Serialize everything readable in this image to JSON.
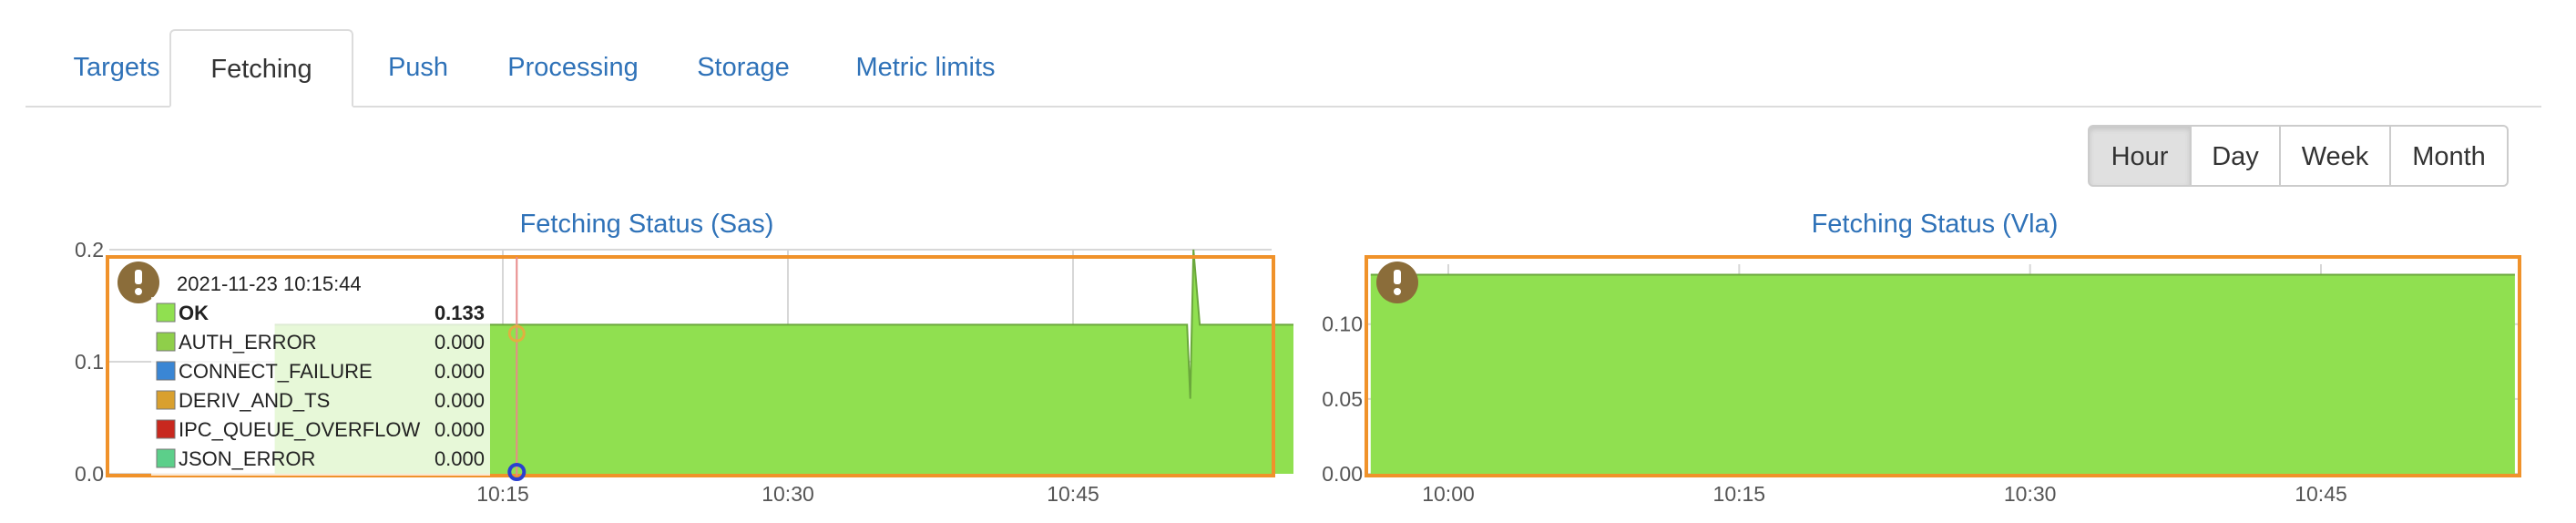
{
  "tabs": [
    {
      "label": "Targets",
      "active": false
    },
    {
      "label": "Fetching",
      "active": true
    },
    {
      "label": "Push",
      "active": false
    },
    {
      "label": "Processing",
      "active": false
    },
    {
      "label": "Storage",
      "active": false
    },
    {
      "label": "Metric limits",
      "active": false
    }
  ],
  "time_range": {
    "options": [
      "Hour",
      "Day",
      "Week",
      "Month"
    ],
    "selected": "Hour"
  },
  "colors": {
    "ok_fill": "#90e050",
    "frame": "#f0922a",
    "alert_icon": "#8b6d3a",
    "link": "#2f72b8"
  },
  "chart_data": [
    {
      "type": "area",
      "title": "Fetching Status (Sas)",
      "x_ticks": [
        "10:15",
        "10:30",
        "10:45"
      ],
      "y_ticks": [
        "0.0",
        "0.1",
        "0.2"
      ],
      "ylim": [
        0,
        0.2
      ],
      "grid": true,
      "series": [
        {
          "name": "OK",
          "x": [
            "10:03",
            "10:51",
            "10:51:10",
            "10:51:20",
            "10:51:40",
            "10:52",
            "10:59"
          ],
          "values": [
            0.133,
            0.133,
            0.067,
            0.2,
            0.133,
            0.133,
            0.133
          ]
        }
      ],
      "tooltip": {
        "timestamp": "2021-11-23 10:15:44",
        "rows": [
          {
            "name": "OK",
            "value": "0.133",
            "color": "#90e050",
            "bold": true
          },
          {
            "name": "AUTH_ERROR",
            "value": "0.000",
            "color": "#8fcf4a",
            "bold": false
          },
          {
            "name": "CONNECT_FAILURE",
            "value": "0.000",
            "color": "#3a86d4",
            "bold": false
          },
          {
            "name": "DERIV_AND_TS",
            "value": "0.000",
            "color": "#d9a02e",
            "bold": false
          },
          {
            "name": "IPC_QUEUE_OVERFLOW",
            "value": "0.000",
            "color": "#c8281e",
            "bold": false
          },
          {
            "name": "JSON_ERROR",
            "value": "0.000",
            "color": "#5ccf8a",
            "bold": false
          }
        ]
      }
    },
    {
      "type": "area",
      "title": "Fetching Status (Vla)",
      "x_ticks": [
        "10:00",
        "10:15",
        "10:30",
        "10:45"
      ],
      "y_ticks": [
        "0.00",
        "0.05",
        "0.10"
      ],
      "ylim": [
        0,
        0.14
      ],
      "grid": true,
      "series": [
        {
          "name": "OK",
          "x": [
            "09:56",
            "10:55"
          ],
          "values": [
            0.133,
            0.133
          ]
        }
      ]
    }
  ]
}
